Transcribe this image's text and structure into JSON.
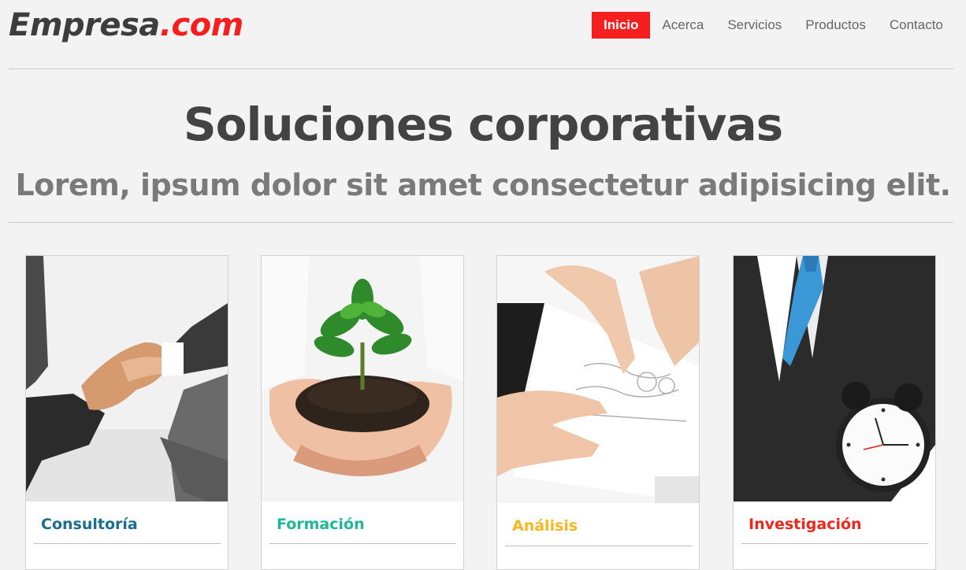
{
  "header": {
    "logo": {
      "name": "Empresa",
      "tld": ".com"
    },
    "nav": [
      {
        "label": "Inicio",
        "active": true
      },
      {
        "label": "Acerca",
        "active": false
      },
      {
        "label": "Servicios",
        "active": false
      },
      {
        "label": "Productos",
        "active": false
      },
      {
        "label": "Contacto",
        "active": false
      }
    ]
  },
  "hero": {
    "title": "Soluciones corporativas",
    "subtitle": "Lorem, ipsum dolor sit amet consectetur adipisicing elit."
  },
  "cards": [
    {
      "title": "Consultoría",
      "color": "#1a6e8e",
      "image": "handshake-photo"
    },
    {
      "title": "Formación",
      "color": "#1fb795",
      "image": "plant-in-hands-photo"
    },
    {
      "title": "Análisis",
      "color": "#f5b822",
      "image": "document-analysis-photo"
    },
    {
      "title": "Investigación",
      "color": "#f0261b",
      "image": "businessman-with-clock-photo"
    }
  ],
  "colors": {
    "accent": "#f51f1f",
    "background": "#f3f3f3"
  }
}
